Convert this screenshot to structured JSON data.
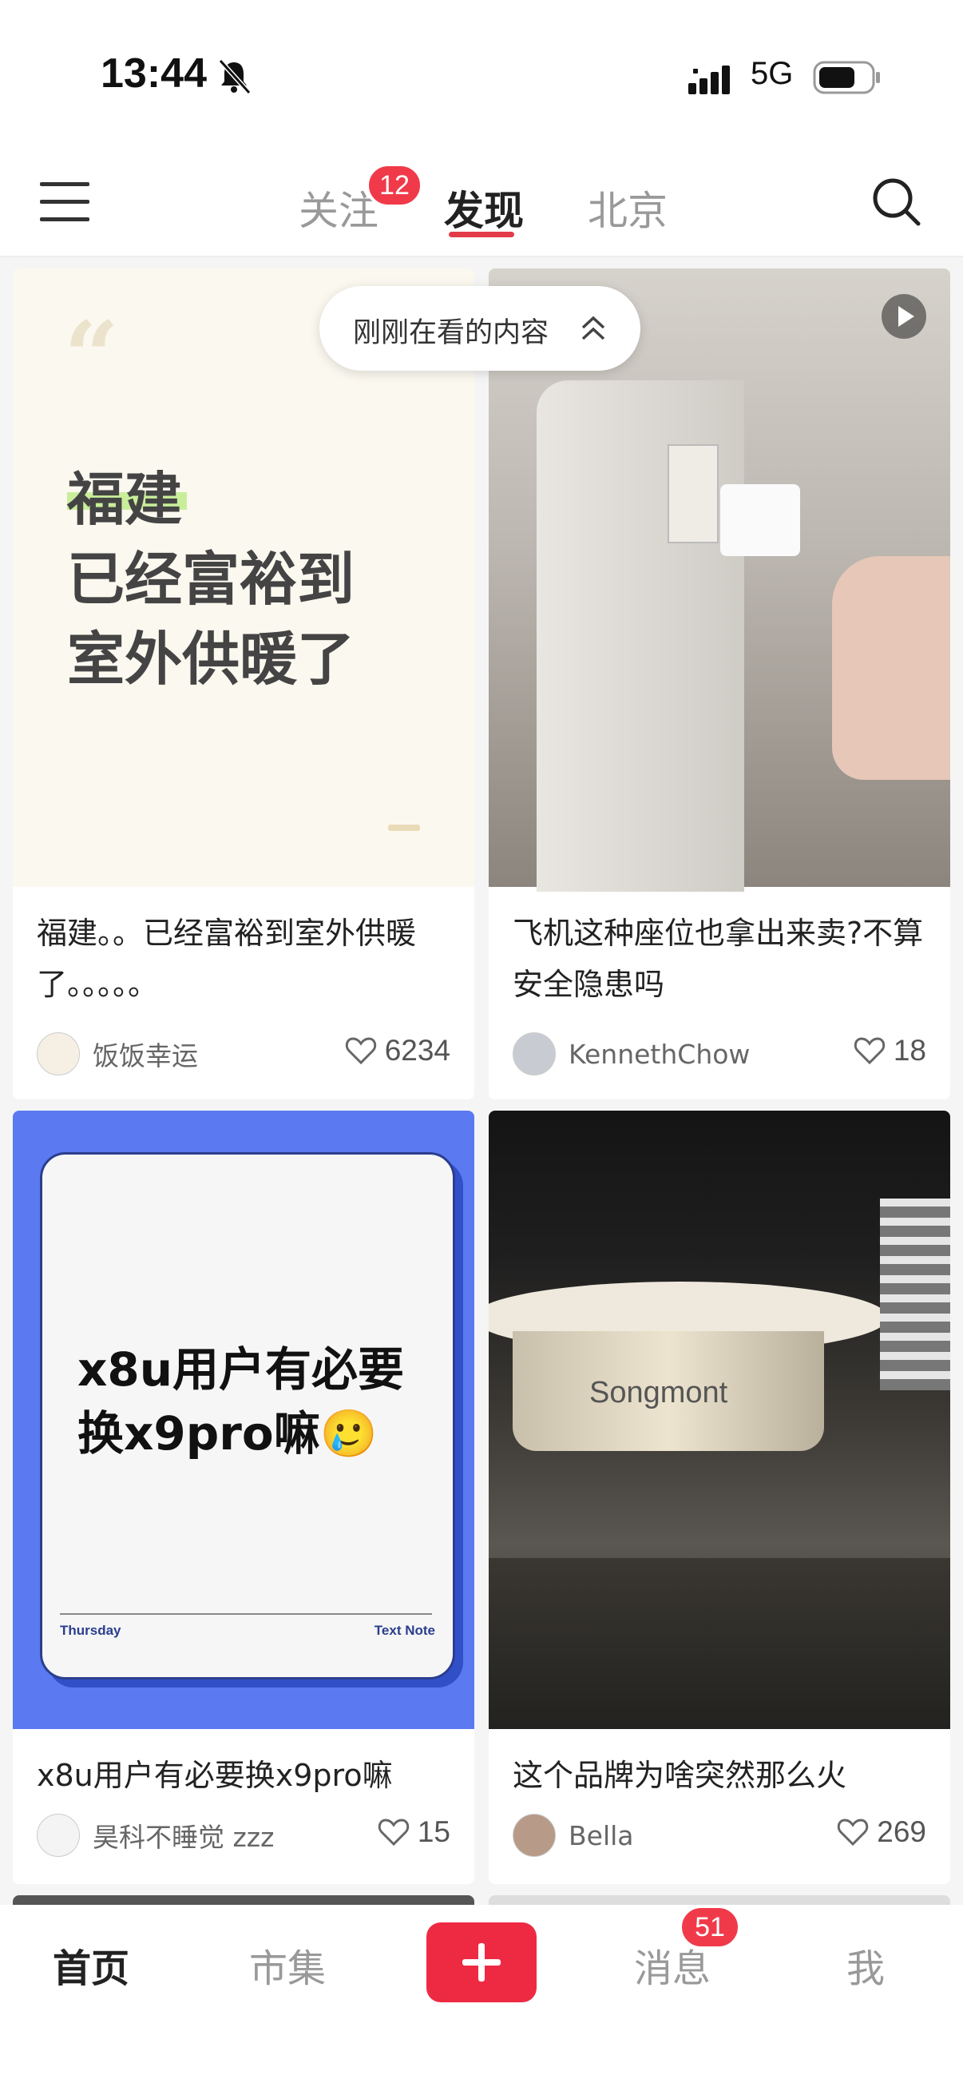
{
  "status_bar": {
    "time": "13:44",
    "network": "5G"
  },
  "nav": {
    "tabs": [
      {
        "label": "关注",
        "badge": "12"
      },
      {
        "label": "发现"
      },
      {
        "label": "北京"
      }
    ],
    "active_tab": "发现"
  },
  "recent_pill": {
    "label": "刚刚在看的内容"
  },
  "feed": [
    {
      "cover_text": [
        "福建",
        "已经富裕到",
        "室外供暖了"
      ],
      "title": "福建。。已经富裕到室外供暖了。。。。。",
      "author": "饭饭幸运",
      "likes": "6234"
    },
    {
      "title": "飞机这种座位也拿出来卖?不算安全隐患吗",
      "author": "KennethChow",
      "likes": "18",
      "is_video": true
    },
    {
      "cover_text": [
        "x8u用户有必要",
        "换x9pro嘛🥲"
      ],
      "cover_footer_left": "Thursday",
      "cover_footer_right": "Text Note",
      "title": "x8u用户有必要换x9pro嘛",
      "author": "昊科不睡觉 zzz",
      "likes": "15"
    },
    {
      "cover_sign": "Songmont",
      "title": "这个品牌为啥突然那么火",
      "author": "Bella",
      "likes": "269"
    }
  ],
  "tabbar": {
    "items": [
      "首页",
      "市集",
      "消息",
      "我"
    ],
    "message_badge": "51",
    "active": "首页"
  },
  "colors": {
    "accent": "#ee2a43",
    "badge": "#f03a4a",
    "card_blue": "#5b79f0"
  }
}
